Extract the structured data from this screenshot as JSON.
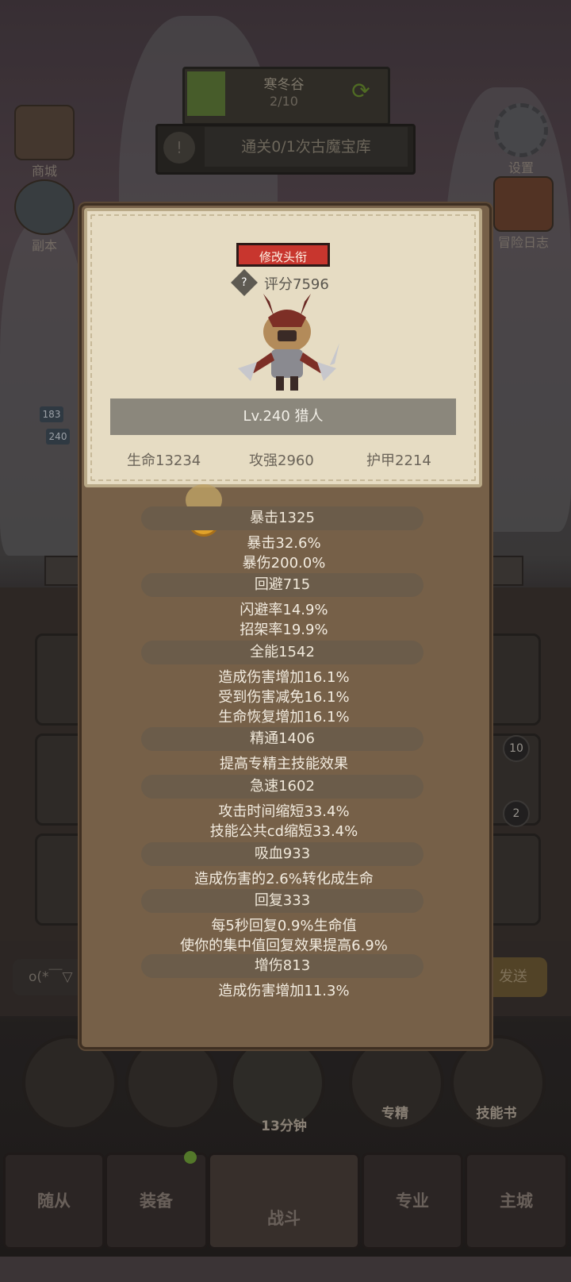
{
  "hud": {
    "quest_title": "寒冬谷",
    "quest_progress": "2/10",
    "task_text": "通关0/1次古魔宝库",
    "task_icon": "!"
  },
  "side_buttons": {
    "left_top": "商城",
    "left_mid": "副本",
    "right_top": "设置",
    "right_mid": "冒险日志"
  },
  "field_levels": [
    "183",
    "240"
  ],
  "chat": {
    "placeholder": "o(*￣▽",
    "send": "发送"
  },
  "skill_badges": {
    "top": "10",
    "bottom": "2"
  },
  "round_buttons": {
    "chest_timer": "13分钟",
    "specialize": "专精",
    "skill_book": "技能书"
  },
  "tabs": {
    "followers": "随从",
    "equipment": "装备",
    "battle": "战斗",
    "profession": "专业",
    "main_city": "主城"
  },
  "panel": {
    "title_button": "修改头衔",
    "score_label": "评分7596",
    "level_class": "Lv.240 猎人",
    "hp": "生命13234",
    "attack": "攻强2960",
    "armor": "护甲2214",
    "stats": [
      {
        "head": "暴击1325",
        "lines": [
          "暴击32.6%",
          "暴伤200.0%"
        ]
      },
      {
        "head": "回避715",
        "lines": [
          "闪避率14.9%",
          "招架率19.9%"
        ]
      },
      {
        "head": "全能1542",
        "lines": [
          "造成伤害增加16.1%",
          "受到伤害减免16.1%",
          "生命恢复增加16.1%"
        ]
      },
      {
        "head": "精通1406",
        "lines": [
          "提高专精主技能效果"
        ]
      },
      {
        "head": "急速1602",
        "lines": [
          "攻击时间缩短33.4%",
          "技能公共cd缩短33.4%"
        ]
      },
      {
        "head": "吸血933",
        "lines": [
          "造成伤害的2.6%转化成生命"
        ]
      },
      {
        "head": "回复333",
        "lines": [
          "每5秒回复0.9%生命值",
          "使你的集中值回复效果提高6.9%"
        ]
      },
      {
        "head": "增伤813",
        "lines": [
          "造成伤害增加11.3%"
        ]
      }
    ]
  }
}
